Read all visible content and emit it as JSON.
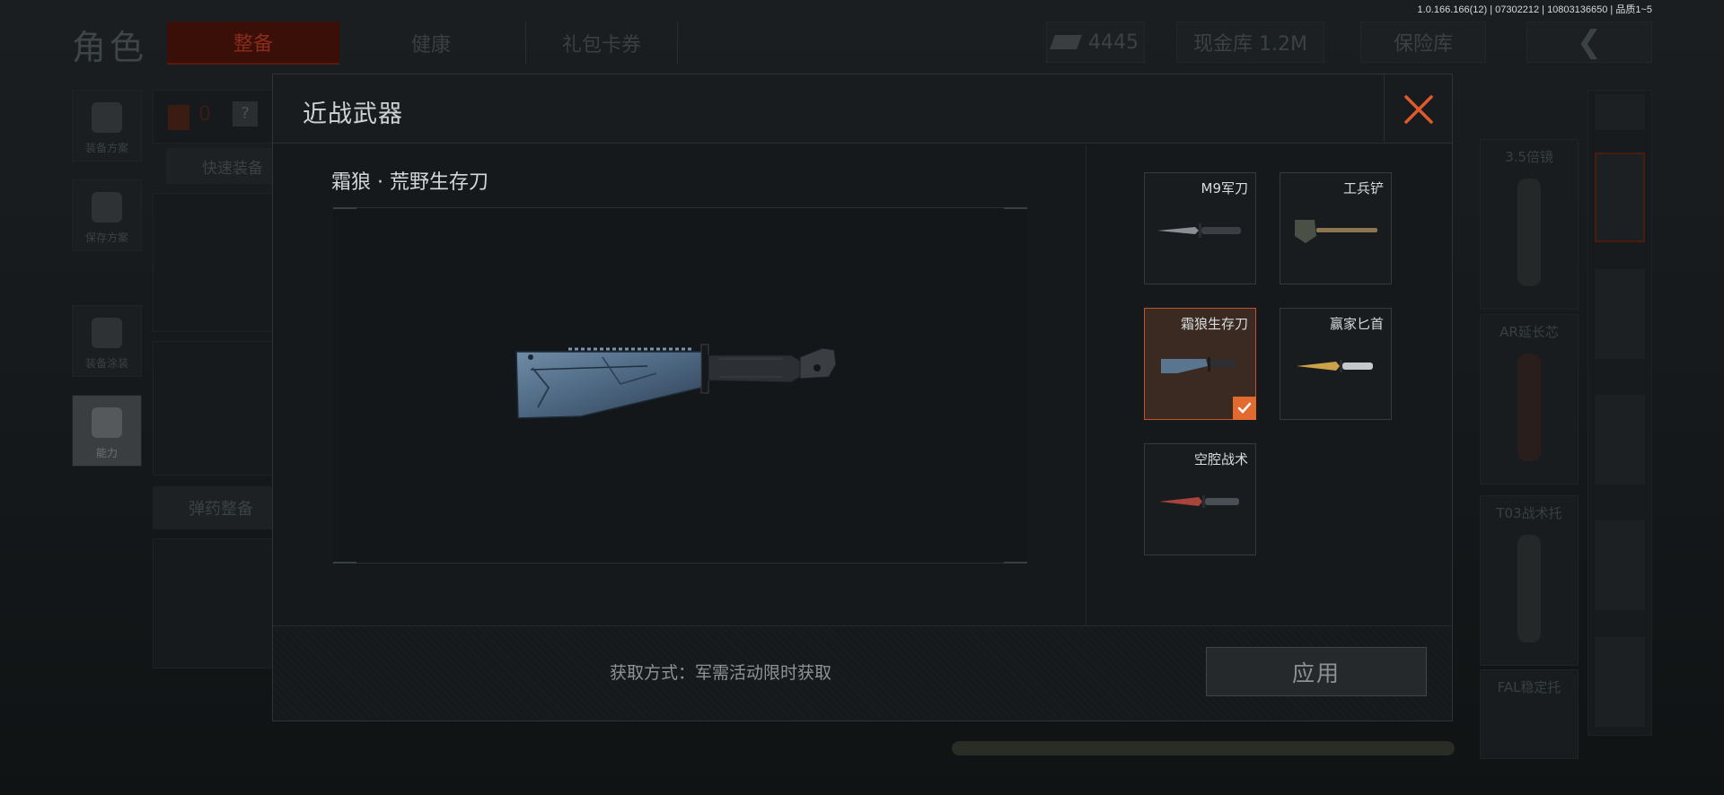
{
  "version_info": "1.0.166.166(12) | 07302212 | 10803136650 | 品质1~5",
  "top_bar": {
    "title": "角色",
    "tabs": [
      {
        "label": "整备",
        "active": true
      },
      {
        "label": "健康",
        "active": false
      },
      {
        "label": "礼包卡券",
        "active": false
      }
    ],
    "currency_value": "4445",
    "vault_label": "现金库 1.2M",
    "safe_label": "保险库",
    "back_icon": "back-arrow-icon"
  },
  "sidebar": {
    "items": [
      {
        "label": "装备方案",
        "icon": "vest-icon"
      },
      {
        "label": "保存方案",
        "icon": "download-icon"
      },
      {
        "label": "装备涂装",
        "icon": "mask-icon"
      },
      {
        "label": "能力",
        "icon": "lightning-icon"
      }
    ]
  },
  "background": {
    "armor_count": "0",
    "help_label": "?",
    "quick_equip": "快速装备",
    "ammo_label": "弹药整备",
    "attachments": [
      "3.5倍镜",
      "AR延长芯",
      "T03战术托",
      "FAL稳定托"
    ]
  },
  "modal": {
    "title": "近战武器",
    "selected_name": "霜狼 · 荒野生存刀",
    "acquire_text": "获取方式：军需活动限时获取",
    "apply_label": "应用",
    "colors": {
      "accent": "#e26a2e",
      "close": "#e05a2b"
    },
    "weapons": [
      {
        "label": "M9军刀",
        "selected": false
      },
      {
        "label": "工兵铲",
        "selected": false
      },
      {
        "label": "霜狼生存刀",
        "selected": true
      },
      {
        "label": "赢家匕首",
        "selected": false
      },
      {
        "label": "空腔战术",
        "selected": false
      }
    ]
  }
}
